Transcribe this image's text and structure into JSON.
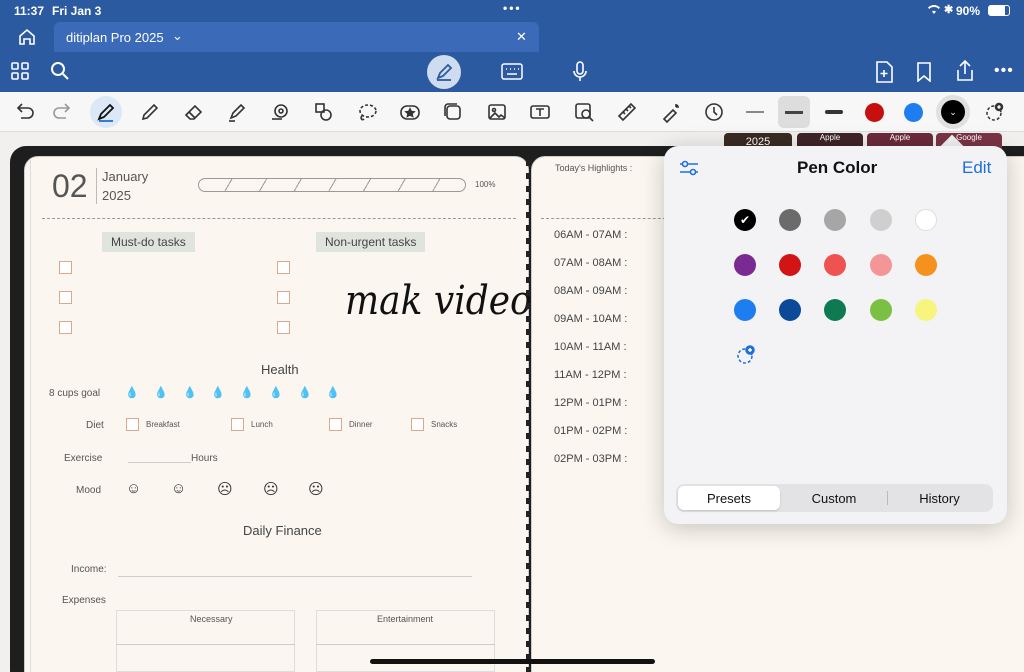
{
  "status": {
    "time": "11:37",
    "date": "Fri Jan 3",
    "battery": "90%"
  },
  "tab": {
    "title": "ditiplan Pro 2025"
  },
  "page": {
    "day": "02",
    "month": "January",
    "year": "2025",
    "progress": "100%",
    "must_do": "Must-do tasks",
    "non_urgent": "Non-urgent tasks",
    "handwriting": "mak video",
    "health": "Health",
    "cups": "8 cups goal",
    "diet": "Diet",
    "diet_items": [
      "Breakfast",
      "Lunch",
      "Dinner",
      "Snacks"
    ],
    "exercise": "Exercise",
    "hours": "Hours",
    "mood": "Mood",
    "finance": "Daily Finance",
    "income": "Income:",
    "expenses": "Expenses",
    "necessary": "Necessary",
    "entertainment": "Entertainment",
    "highlights": "Today's Highlights :",
    "times": [
      "06AM - 07AM :",
      "07AM - 08AM :",
      "08AM - 09AM :",
      "09AM - 10AM :",
      "10AM - 11AM :",
      "11AM - 12PM :",
      "12PM - 01PM :",
      "01PM - 02PM :",
      "02PM - 03PM :"
    ],
    "month_tabs": [
      "2025",
      "Apple",
      "Apple",
      "Google"
    ]
  },
  "popover": {
    "title": "Pen Color",
    "edit": "Edit",
    "segments": [
      "Presets",
      "Custom",
      "History"
    ]
  },
  "colors": [
    "#000000",
    "#6b6b6b",
    "#a6a6a6",
    "#cfcfcf",
    "#ffffff",
    "#7b2a92",
    "#d21414",
    "#ef5350",
    "#f49597",
    "#f5921e",
    "#1e7ef0",
    "#0b4a99",
    "#0e7a52",
    "#7ac043",
    "#f7f57d"
  ]
}
